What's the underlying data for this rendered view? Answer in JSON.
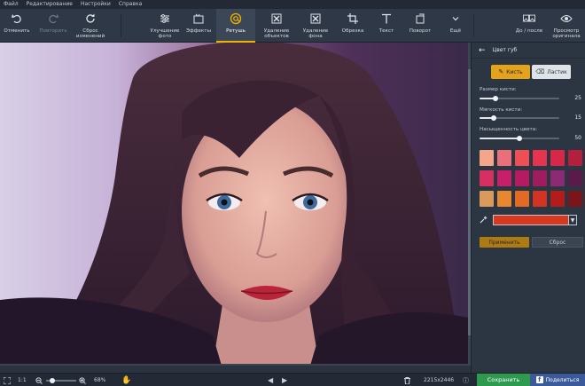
{
  "menu": [
    "Файл",
    "Редактирование",
    "Настройки",
    "Справка"
  ],
  "toolbar": {
    "undo": "Отменить",
    "redo": "Повторить",
    "reset_changes": "Сброс изменений",
    "enhance": "Улучшение фото",
    "effects": "Эффекты",
    "retouch": "Ретушь",
    "object_removal": "Удаление объектов",
    "bg_removal": "Удаление фона",
    "crop": "Обрезка",
    "text": "Текст",
    "rotate": "Поворот",
    "more": "Ещё",
    "before_after": "До / после",
    "preview": "Просмотр оригинала"
  },
  "panel": {
    "title": "Цвет губ",
    "brush": "Кисть",
    "eraser": "Ластик",
    "sliders": [
      {
        "label": "Размер кисти:",
        "value": 25,
        "fraction": 0.2
      },
      {
        "label": "Мягкость кисти:",
        "value": 15,
        "fraction": 0.18
      },
      {
        "label": "Насыщенность цвета:",
        "value": 50,
        "fraction": 0.5
      }
    ],
    "swatches": [
      "#f4a58a",
      "#ea6f79",
      "#ee4f55",
      "#e4344f",
      "#d8284a",
      "#b31f3d",
      "#d62f62",
      "#c81f6a",
      "#b51a63",
      "#a11b5f",
      "#8c2a73",
      "#5a1b4a",
      "#d99a5b",
      "#e9872f",
      "#e26a23",
      "#d33322",
      "#b41c1b",
      "#7c141c"
    ],
    "selected_color": "#d8381d",
    "apply": "Применить",
    "reset": "Сброс"
  },
  "status": {
    "ratio": "1:1",
    "zoom": "68%",
    "image_size": "2215x2446",
    "save": "Сохранить",
    "share": "Поделиться"
  },
  "colors": {
    "accent": "#e5a31b",
    "save": "#2e9a4f",
    "share": "#3b5a9a"
  }
}
